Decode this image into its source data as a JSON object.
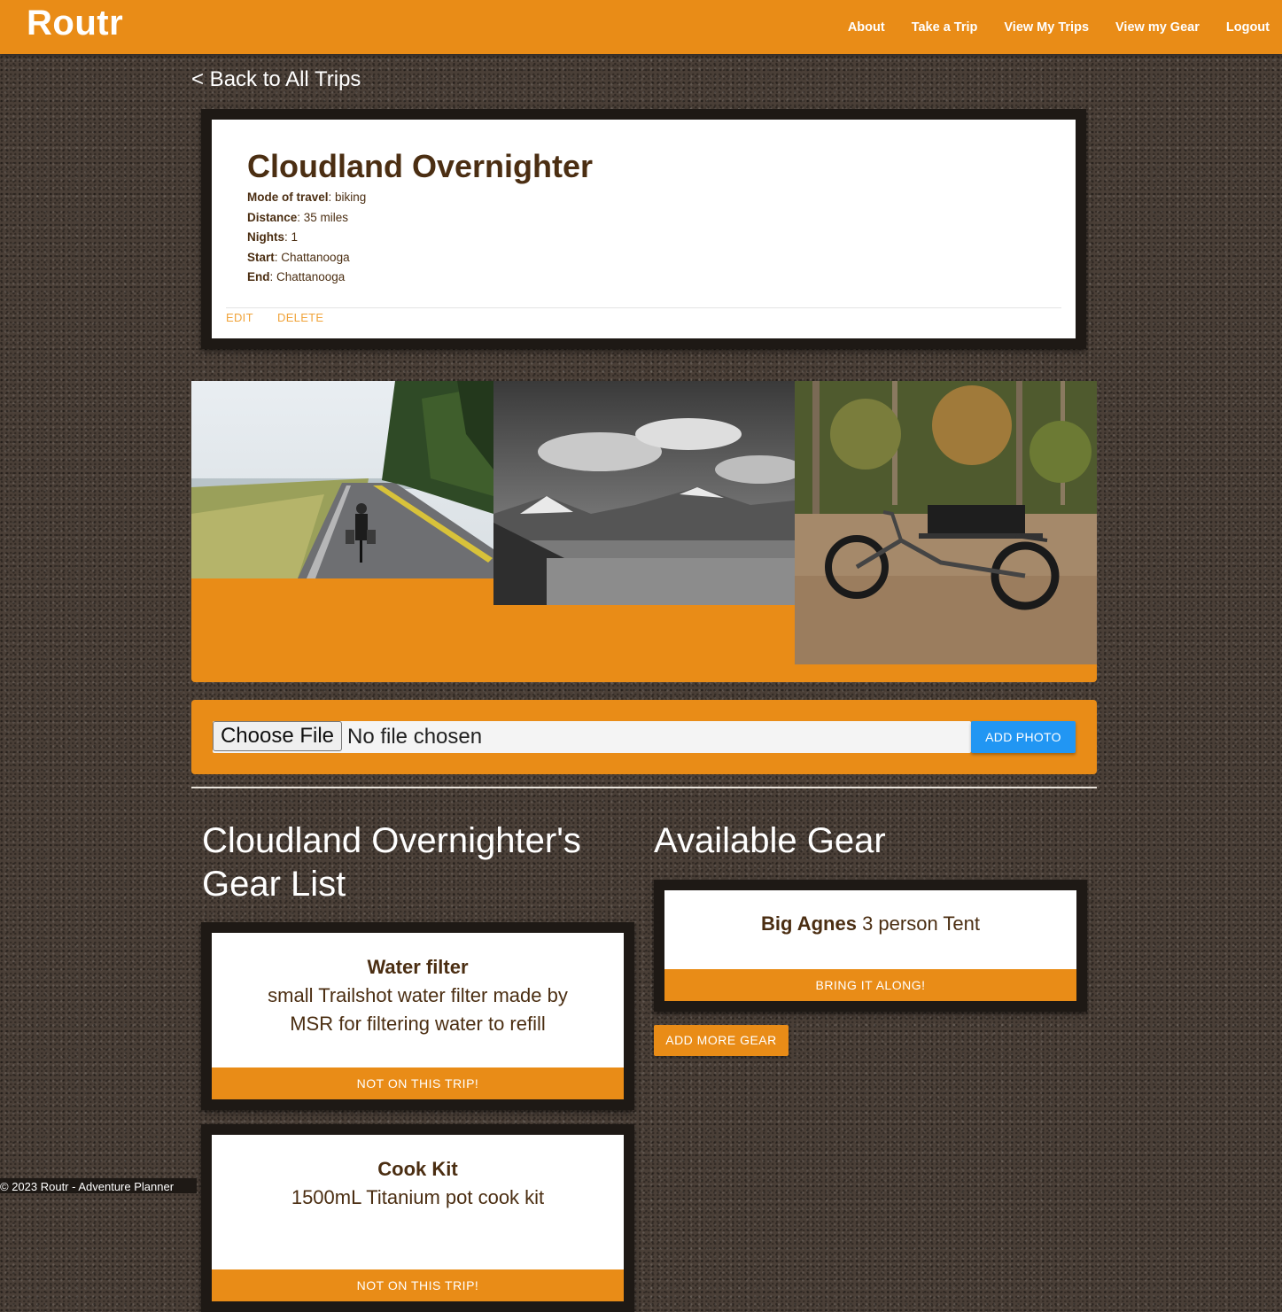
{
  "nav": {
    "brand": "Routr",
    "links": [
      "About",
      "Take a Trip",
      "View My Trips",
      "View my Gear",
      "Logout"
    ]
  },
  "back_link": "< Back to All Trips",
  "trip": {
    "title": "Cloudland Overnighter",
    "details": [
      {
        "label": "Mode of travel",
        "value": ": biking"
      },
      {
        "label": "Distance",
        "value": ": 35 miles"
      },
      {
        "label": "Nights",
        "value": ": 1"
      },
      {
        "label": "Start",
        "value": ": Chattanooga"
      },
      {
        "label": "End",
        "value": ": Chattanooga"
      }
    ],
    "edit_label": "EDIT",
    "delete_label": "DELETE"
  },
  "upload": {
    "choose_label": "Choose File",
    "status": "No file chosen",
    "add_photo_label": "ADD PHOTO"
  },
  "gear_list": {
    "heading": "Cloudland Overnighter's Gear List",
    "items": [
      {
        "name": "Water filter",
        "desc": "small Trailshot water filter made by MSR for filtering water to refill",
        "button": "NOT ON THIS TRIP!"
      },
      {
        "name": "Cook Kit",
        "desc": "1500mL Titanium pot cook kit",
        "button": "NOT ON THIS TRIP!"
      }
    ]
  },
  "available_gear": {
    "heading": "Available Gear",
    "items": [
      {
        "brand": "Big Agnes",
        "name": " 3 person Tent",
        "button": "BRING IT ALONG!"
      }
    ],
    "add_more_label": "ADD MORE GEAR"
  },
  "footer": "© 2023 Routr - Adventure Planner",
  "colors": {
    "accent": "#e98c17",
    "text_brown": "#4b2e12",
    "button_blue": "#2196f3",
    "card_frame": "#1e1915"
  }
}
